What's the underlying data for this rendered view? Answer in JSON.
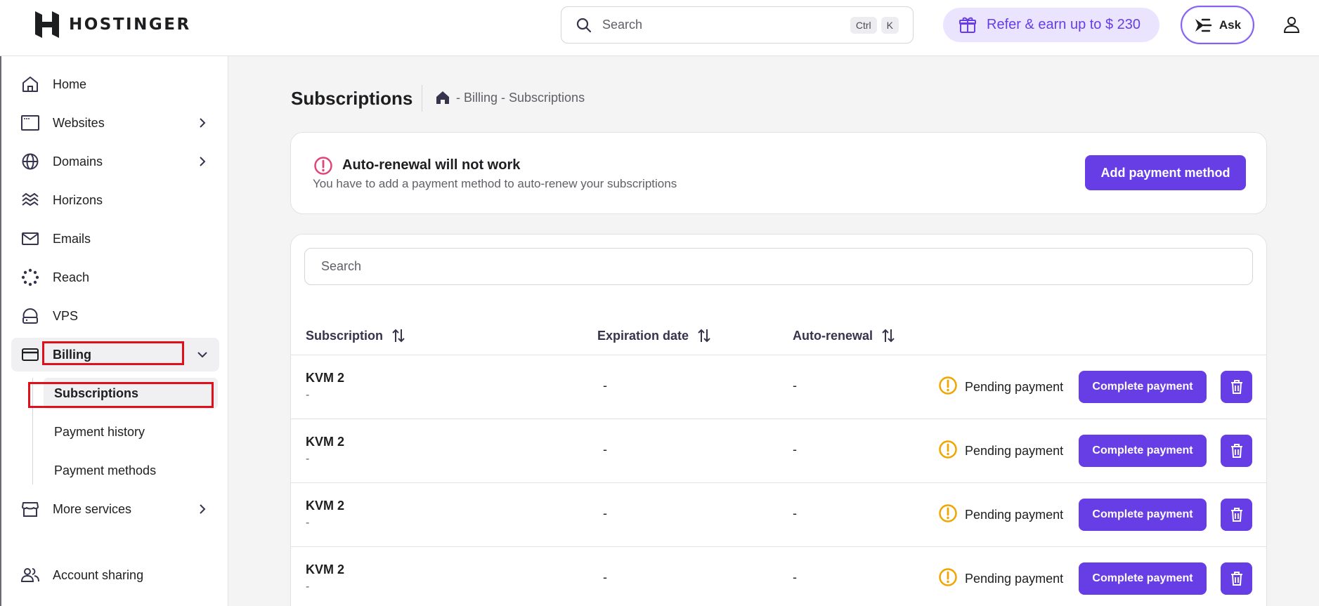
{
  "brand": {
    "name": "HOSTINGER"
  },
  "topbar": {
    "search_placeholder": "Search",
    "shortcut_keys": [
      "Ctrl",
      "K"
    ],
    "refer_label": "Refer & earn up to $ 230",
    "ask_label": "Ask"
  },
  "sidebar": {
    "items": [
      {
        "label": "Home",
        "icon": "home-icon"
      },
      {
        "label": "Websites",
        "icon": "browser-icon"
      },
      {
        "label": "Domains",
        "icon": "globe-icon"
      },
      {
        "label": "Horizons",
        "icon": "horizons-icon"
      },
      {
        "label": "Emails",
        "icon": "mail-icon"
      },
      {
        "label": "Reach",
        "icon": "reach-icon"
      },
      {
        "label": "VPS",
        "icon": "server-icon"
      },
      {
        "label": "Billing",
        "icon": "card-icon"
      },
      {
        "label": "More services",
        "icon": "store-icon"
      },
      {
        "label": "Account sharing",
        "icon": "users-icon"
      }
    ],
    "billing_sub": [
      "Subscriptions",
      "Payment history",
      "Payment methods"
    ]
  },
  "page": {
    "title": "Subscriptions",
    "breadcrumb": "- Billing - Subscriptions"
  },
  "alert": {
    "title": "Auto-renewal will not work",
    "message": "You have to add a payment method to auto-renew your subscriptions",
    "button": "Add payment method"
  },
  "table": {
    "search_placeholder": "Search",
    "columns": [
      "Subscription",
      "Expiration date",
      "Auto-renewal"
    ],
    "rows": [
      {
        "name": "KVM 2",
        "sub": "-",
        "expiration": "-",
        "auto_renewal": "-",
        "status": "Pending payment",
        "action": "Complete payment"
      },
      {
        "name": "KVM 2",
        "sub": "-",
        "expiration": "-",
        "auto_renewal": "-",
        "status": "Pending payment",
        "action": "Complete payment"
      },
      {
        "name": "KVM 2",
        "sub": "-",
        "expiration": "-",
        "auto_renewal": "-",
        "status": "Pending payment",
        "action": "Complete payment"
      },
      {
        "name": "KVM 2",
        "sub": "-",
        "expiration": "-",
        "auto_renewal": "-",
        "status": "Pending payment",
        "action": "Complete payment"
      }
    ]
  },
  "colors": {
    "accent": "#673de6",
    "warning": "#f0a500",
    "danger": "#e0457b",
    "highlight": "#e0101a"
  }
}
